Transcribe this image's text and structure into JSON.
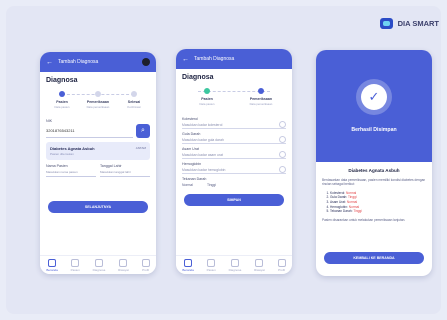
{
  "brand": {
    "name": "DIA SMART"
  },
  "screen1": {
    "topbar_title": "Tambah Diagnosa",
    "title": "Diagnosa",
    "steps": [
      {
        "label": "Pasien",
        "sub": "Data pasien"
      },
      {
        "label": "Pemeriksaan",
        "sub": "Data pemeriksaan"
      },
      {
        "label": "Selesai",
        "sub": "Konfirmasi"
      }
    ],
    "search_label": "NIK",
    "search_value": "3201876543211",
    "result_title": "Diabetes Agnata Asbuh",
    "result_sub": "Pasien ditemukan",
    "result_right": "ANTAM",
    "left_label": "Nama Pasien",
    "left_value": "Masukkan nama pasien",
    "right_label": "Tanggal Lahir",
    "right_value": "Masukkan tanggal lahir",
    "button": "SELANJUTNYA",
    "nav": [
      "Beranda",
      "Pasien",
      "Diagnosa",
      "Riwayat",
      "Profil"
    ]
  },
  "screen2": {
    "topbar_title": "Tambah Diagnosa",
    "title": "Diagnosa",
    "steps": [
      {
        "label": "Pasien",
        "sub": "Data pasien"
      },
      {
        "label": "Pemeriksaan",
        "sub": "Data pemeriksaan"
      }
    ],
    "fields": [
      {
        "label": "Kolesterol",
        "value": "Masukkan kadar kolesterol"
      },
      {
        "label": "Gula Darah",
        "value": "Masukkan kadar gula darah"
      },
      {
        "label": "Asam Urat",
        "value": "Masukkan kadar asam urat"
      },
      {
        "label": "Hemoglobin",
        "value": "Masukkan kadar hemoglobin"
      }
    ],
    "radio_label": "Tekanan Darah",
    "radio_options": [
      "Normal",
      "Tinggi"
    ],
    "button": "SIMPAN",
    "nav": [
      "Beranda",
      "Pasien",
      "Diagnosa",
      "Riwayat",
      "Profil"
    ]
  },
  "screen3": {
    "hero_title": "Berhasil Disimpan",
    "heading": "Diabetes Agnata Asbuh",
    "para": "Berdasarkan data pemeriksaan, pasien memiliki kondisi diabetes dengan rincian sebagai berikut:",
    "items": [
      {
        "text": "Kolesterol: ",
        "status": "Normal"
      },
      {
        "text": "Gula Darah: ",
        "status": "Tinggi"
      },
      {
        "text": "Asam Urat: ",
        "status": "Normal"
      },
      {
        "text": "Hemoglobin: ",
        "status": "Normal"
      },
      {
        "text": "Tekanan Darah: ",
        "status": "Tinggi"
      }
    ],
    "para2": "Pasien disarankan untuk melakukan pemeriksaan lanjutan.",
    "button": "KEMBALI KE BERANDA"
  },
  "colors": {
    "primary": "#4a5fd6",
    "success": "#3cc79f",
    "alert": "#e2474b"
  }
}
